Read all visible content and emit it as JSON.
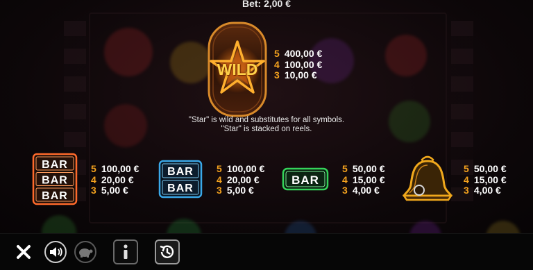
{
  "header": {
    "bet_text": "Bet: 2,00 €"
  },
  "wild": {
    "symbol_label": "WILD",
    "symbol_icon": "star-wild-icon",
    "payouts": [
      {
        "count": "5",
        "amount": "400,00 €"
      },
      {
        "count": "4",
        "amount": "100,00 €"
      },
      {
        "count": "3",
        "amount": "10,00 €"
      }
    ],
    "description_line1": "\"Star\" is wild and substitutes for all symbols.",
    "description_line2": "\"Star\" is stacked on reels."
  },
  "symbols": [
    {
      "name": "triple-bar",
      "icon": "triple-bar-icon",
      "labels": [
        "BAR",
        "BAR",
        "BAR"
      ],
      "color": "#ff6a2b",
      "payouts": [
        {
          "count": "5",
          "amount": "100,00 €"
        },
        {
          "count": "4",
          "amount": "20,00 €"
        },
        {
          "count": "3",
          "amount": "5,00 €"
        }
      ]
    },
    {
      "name": "double-bar",
      "icon": "double-bar-icon",
      "labels": [
        "BAR",
        "BAR"
      ],
      "color": "#3aa8e8",
      "payouts": [
        {
          "count": "5",
          "amount": "100,00 €"
        },
        {
          "count": "4",
          "amount": "20,00 €"
        },
        {
          "count": "3",
          "amount": "5,00 €"
        }
      ]
    },
    {
      "name": "single-bar",
      "icon": "single-bar-icon",
      "labels": [
        "BAR"
      ],
      "color": "#35d35a",
      "payouts": [
        {
          "count": "5",
          "amount": "50,00 €"
        },
        {
          "count": "4",
          "amount": "15,00 €"
        },
        {
          "count": "3",
          "amount": "4,00 €"
        }
      ]
    },
    {
      "name": "bell",
      "icon": "bell-icon",
      "color": "#f0a81c",
      "payouts": [
        {
          "count": "5",
          "amount": "50,00 €"
        },
        {
          "count": "4",
          "amount": "15,00 €"
        },
        {
          "count": "3",
          "amount": "4,00 €"
        }
      ]
    }
  ],
  "toolbar": {
    "close_icon": "close-icon",
    "sound_icon": "sound-icon",
    "turbo_icon": "turtle-icon",
    "info_icon": "info-icon",
    "history_icon": "history-icon"
  },
  "colors": {
    "count_color": "#f4a21e",
    "accent_orange": "#f5a623"
  }
}
